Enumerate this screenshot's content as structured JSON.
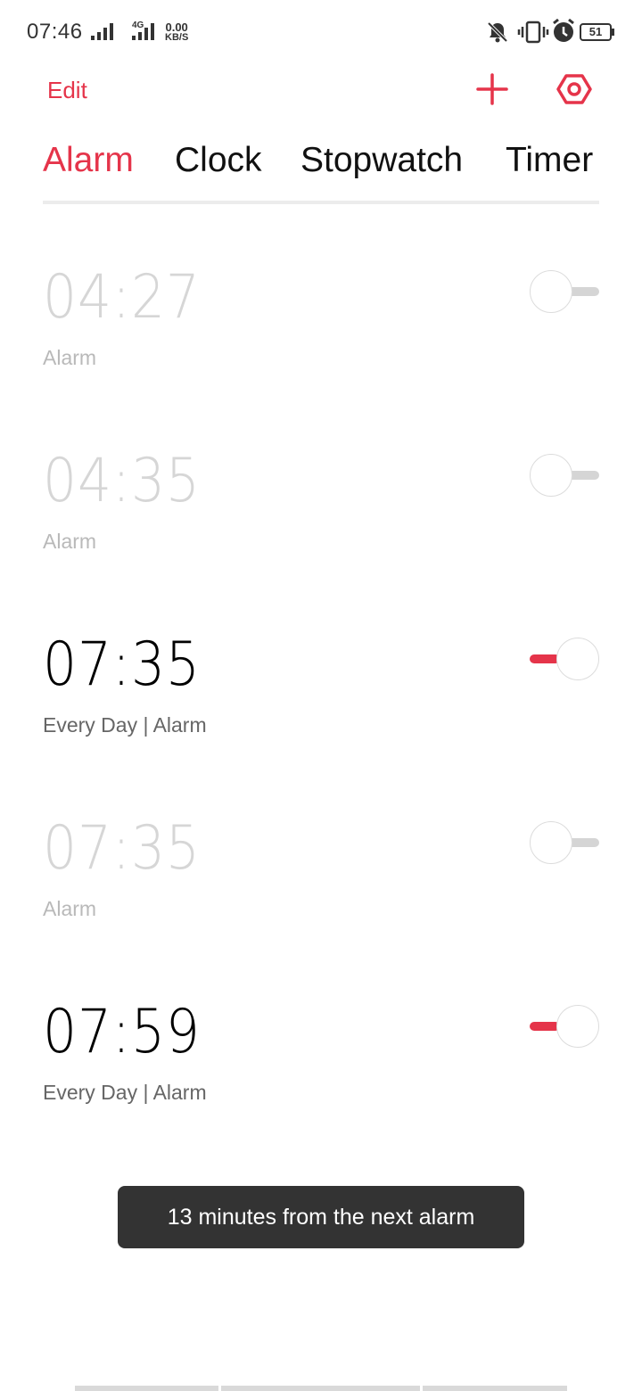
{
  "status_bar": {
    "time": "07:46",
    "net_speed_value": "0.00",
    "net_speed_unit": "KB/S",
    "network_type": "4G",
    "battery": "51",
    "icons": [
      "signal-icon",
      "4g-signal-icon",
      "mute-icon",
      "vibrate-icon",
      "alarm-icon",
      "battery-icon"
    ]
  },
  "header": {
    "edit_label": "Edit",
    "add_icon": "plus-icon",
    "settings_icon": "settings-icon"
  },
  "tabs": [
    {
      "label": "Alarm",
      "active": true
    },
    {
      "label": "Clock",
      "active": false
    },
    {
      "label": "Stopwatch",
      "active": false
    },
    {
      "label": "Timer",
      "active": false
    }
  ],
  "alarms": [
    {
      "time": "04:27",
      "label": "Alarm",
      "enabled": false
    },
    {
      "time": "04:35",
      "label": "Alarm",
      "enabled": false
    },
    {
      "time": "07:35",
      "label": "Every Day | Alarm",
      "enabled": true
    },
    {
      "time": "07:35",
      "label": "Alarm",
      "enabled": false
    },
    {
      "time": "07:59",
      "label": "Every Day | Alarm",
      "enabled": true
    }
  ],
  "toast": {
    "message": "13 minutes from the next alarm"
  },
  "colors": {
    "accent": "#e5344a",
    "toggle_off": "#d5d5d5",
    "disabled_text": "#d6d6d6"
  }
}
